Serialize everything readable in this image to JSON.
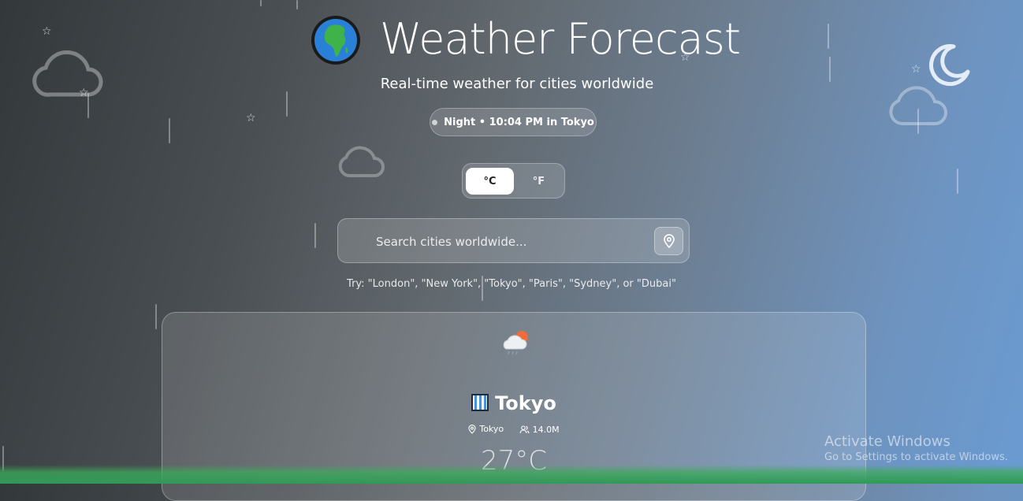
{
  "header": {
    "title": "Weather Forecast",
    "subtitle": "Real-time weather for cities worldwide",
    "logo_icon": "globe-africa-icon"
  },
  "status_pill": {
    "text": "Night • 10:04 PM in Tokyo"
  },
  "units": {
    "celsius_label": "°C",
    "fahrenheit_label": "°F",
    "selected": "°C"
  },
  "search": {
    "placeholder": "Search cities worldwide...",
    "value": "",
    "location_icon": "map-pin-icon"
  },
  "hint": "Try: \"London\", \"New York\", \"Tokyo\", \"Paris\", \"Sydney\", or \"Dubai\"",
  "weather_card": {
    "condition_icon": "sun-behind-rain-cloud-icon",
    "city_icon": "office-building-icon",
    "city": "Tokyo",
    "location": "Tokyo",
    "population": "14.0M",
    "temperature": "27°C"
  },
  "watermark": {
    "line1": "Activate Windows",
    "line2": "Go to Settings to activate Windows."
  },
  "colors": {
    "background_left": "#33383b",
    "background_right": "#6a9bd2",
    "ground": "#2f9a57"
  }
}
